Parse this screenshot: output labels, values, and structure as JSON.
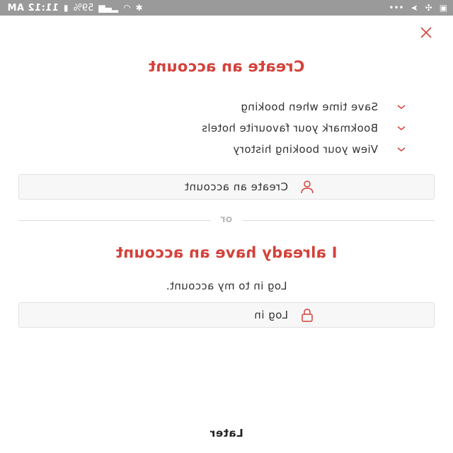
{
  "status_bar": {
    "time": "11:12 AM",
    "battery": "59%"
  },
  "create_section": {
    "title": "Create an account",
    "benefits": [
      "Save time when booking",
      "Bookmark your favourite hotels",
      "View your booking history"
    ],
    "button_label": "Create an account"
  },
  "divider": {
    "label": "or"
  },
  "login_section": {
    "title": "I already have an account",
    "subtitle": "Log in to my account.",
    "button_label": "Log in"
  },
  "footer": {
    "later_label": "Later"
  },
  "colors": {
    "accent": "#d4413a",
    "status_bar": "#9a9a9a",
    "button_bg": "#f7f7f7"
  },
  "icons": {
    "close": "close-icon",
    "chevron": "chevron-down-icon",
    "user": "user-icon",
    "lock": "lock-icon"
  }
}
